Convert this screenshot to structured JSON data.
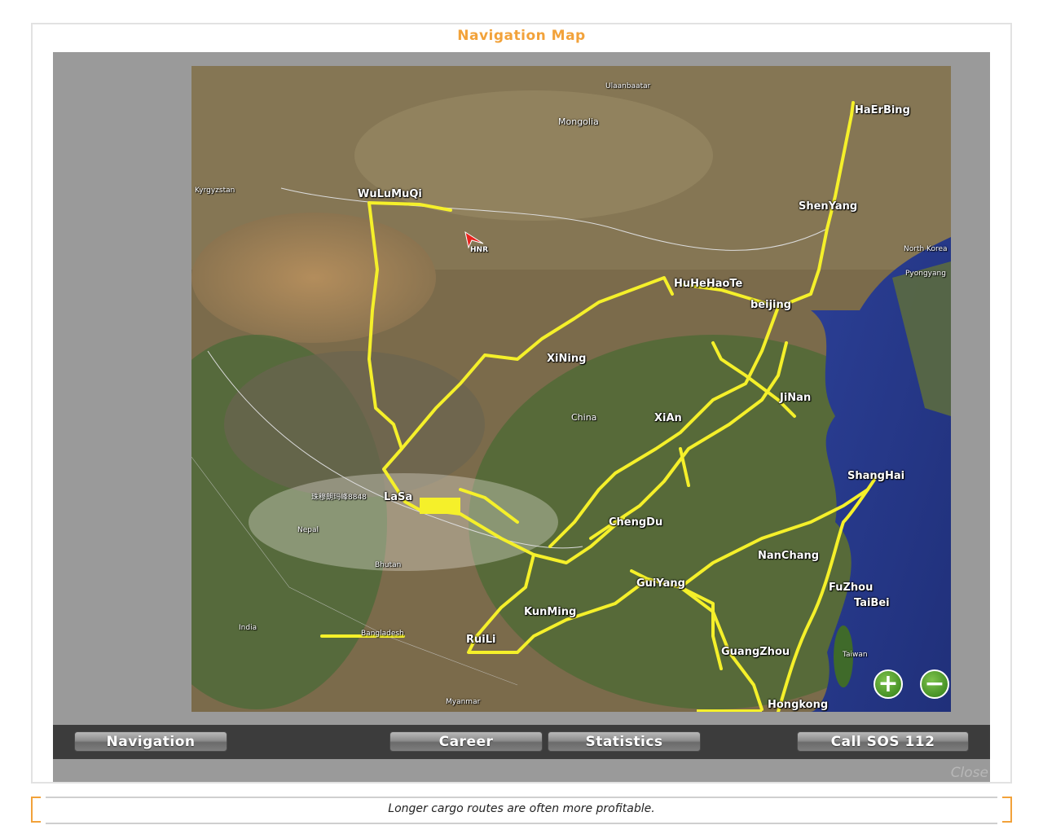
{
  "window": {
    "title": "Navigation Map"
  },
  "map": {
    "cities": [
      {
        "name": "HaErBing"
      },
      {
        "name": "ShenYang"
      },
      {
        "name": "WuLuMuQi"
      },
      {
        "name": "HuHeHaoTe"
      },
      {
        "name": "beijing"
      },
      {
        "name": "XiNing"
      },
      {
        "name": "JiNan"
      },
      {
        "name": "XiAn"
      },
      {
        "name": "ShangHai"
      },
      {
        "name": "LaSa"
      },
      {
        "name": "ChengDu"
      },
      {
        "name": "NanChang"
      },
      {
        "name": "GuiYang"
      },
      {
        "name": "FuZhou"
      },
      {
        "name": "TaiBei"
      },
      {
        "name": "KunMing"
      },
      {
        "name": "RuiLi"
      },
      {
        "name": "GuangZhou"
      },
      {
        "name": "Hongkong"
      }
    ],
    "labels": {
      "mongolia": "Mongolia",
      "china": "China",
      "ulaanbaatar": "Ulaanbaatar",
      "nepal": "Nepal",
      "bhutan": "Bhutan",
      "india": "India",
      "bangladesh": "Bangladesh",
      "myanmar": "Myanmar",
      "taiwan": "Taiwan",
      "everest": "珠穆朗玛峰8848",
      "kyrgyzstan": "Kyrgyzstan",
      "north_korea": "North Korea",
      "pyongyang": "Pyongyang"
    },
    "player_marker": "HNR",
    "zoom_in_icon": "zoom-in-icon",
    "zoom_out_icon": "zoom-out-icon",
    "colors": {
      "route": "#f5f02a",
      "marker": "#e8231e",
      "accent": "#f2a23a"
    }
  },
  "toolbar": {
    "navigation": "Navigation",
    "career": "Career",
    "statistics": "Statistics",
    "sos": "Call SOS 112"
  },
  "close_label": "Close",
  "tip": "Longer cargo routes are often more profitable."
}
